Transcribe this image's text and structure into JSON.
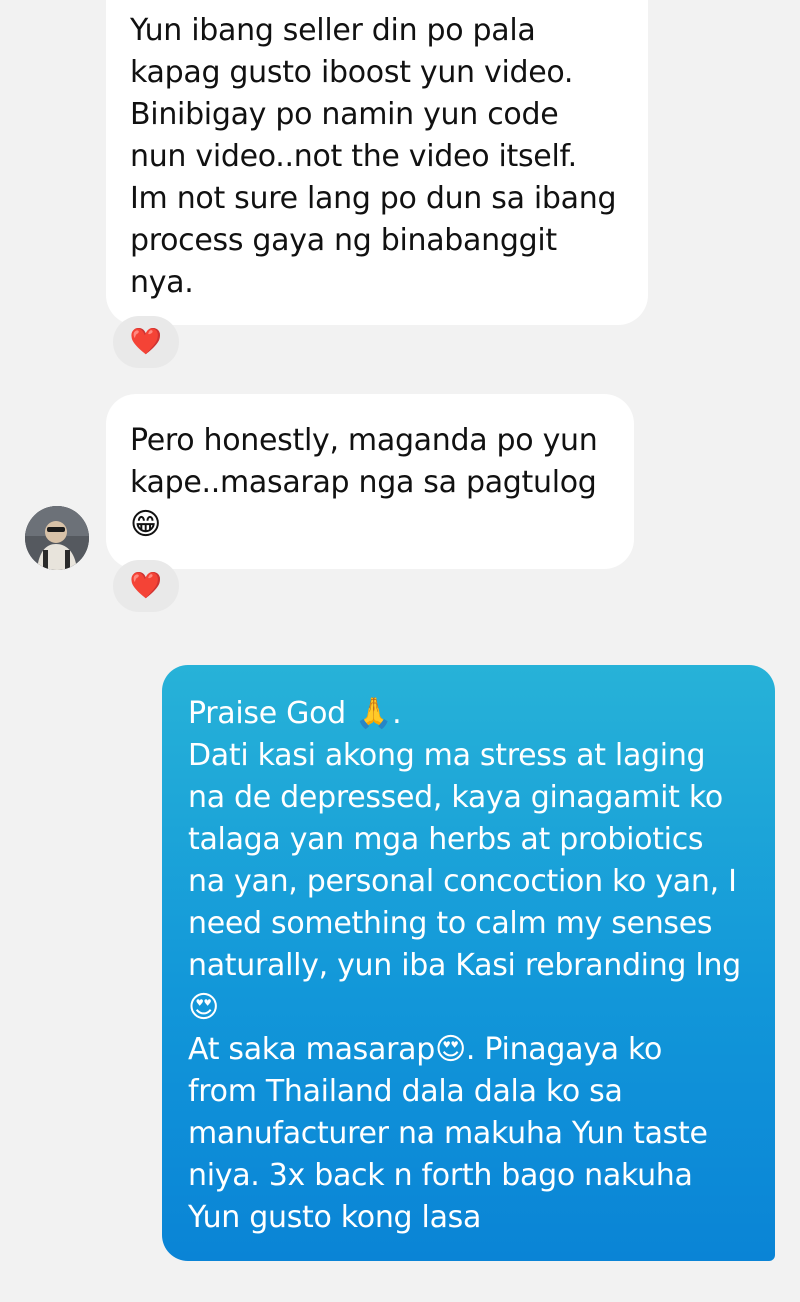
{
  "messages": [
    {
      "lines": [
        "Yun ibang seller din po pala",
        "kapag gusto iboost yun video.",
        "Binibigay po namin yun code",
        "nun video..not the video itself.",
        "Im not sure lang po dun sa ibang",
        "process gaya ng binabanggit",
        "nya."
      ],
      "reaction": "❤️"
    },
    {
      "lines": [
        "Pero honestly, maganda po yun",
        "kape..masarap nga sa pagtulog"
      ],
      "emoji": "😁",
      "reaction": "❤️"
    },
    {
      "lines": [
        "Praise God 🙏.",
        "Dati kasi akong ma stress at laging",
        "na de depressed, kaya ginagamit ko",
        "talaga yan mga herbs at probiotics",
        "na yan, personal concoction ko yan, I",
        "need something to calm my senses",
        "naturally, yun iba Kasi rebranding lng",
        "😍",
        "At saka masarap😍. Pinagaya ko",
        "from Thailand dala dala ko sa",
        "manufacturer na makuha Yun taste",
        "niya. 3x back n forth bago nakuha",
        "Yun gusto kong lasa"
      ]
    }
  ],
  "colors": {
    "background": "#f2f2f2",
    "incoming_bubble": "#ffffff",
    "outgoing_bubble": "#1297d9",
    "reaction_bg": "#e9e9e9"
  }
}
